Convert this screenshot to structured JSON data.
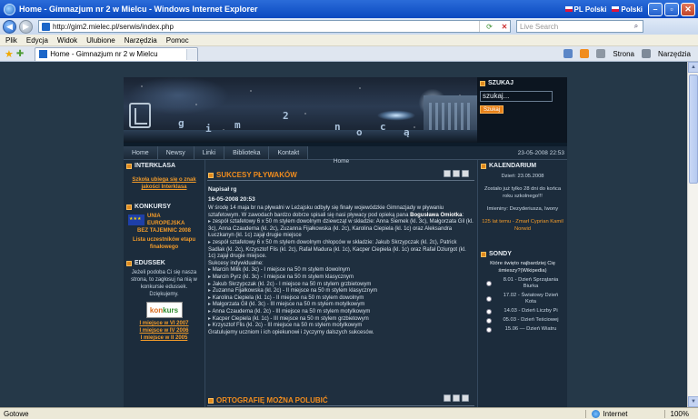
{
  "window": {
    "title": "Home - Gimnazjum nr 2 w Mielcu - Windows Internet Explorer",
    "lang1": "PL Polski",
    "lang2": "Polski"
  },
  "address": {
    "url": "http://gim2.mielec.pl/serwis/index.php",
    "search_placeholder": "Live Search"
  },
  "menu": [
    "Plik",
    "Edycja",
    "Widok",
    "Ulubione",
    "Narzędzia",
    "Pomoc"
  ],
  "tab": {
    "label": "Home - Gimnazjum nr 2 w Mielcu"
  },
  "tools": {
    "strona": "Strona",
    "narzedzia": "Narzędzia"
  },
  "status": {
    "left": "Gotowe",
    "zone": "Internet",
    "zoom": "100%"
  },
  "site": {
    "banner_letters": [
      "g",
      "i",
      "m",
      "2",
      "n",
      "o",
      "c",
      "ą"
    ],
    "search": {
      "title": "SZUKAJ",
      "value": "szukaj...",
      "button": "Szukaj"
    },
    "nav": [
      "Home",
      "Newsy",
      "Linki",
      "Biblioteka",
      "Kontakt"
    ],
    "datetime": "23-05-2008 22:53",
    "breadcrumb": "Home",
    "left": {
      "interklasa": {
        "title": "INTERKLASA",
        "text": "Szkoła ubiega się o znak jakości Interklasa"
      },
      "konkursy": {
        "title": "KONKURSY",
        "eu1": "UNIA",
        "eu2": "EUROPEJSKA",
        "eu3": "BEZ TAJEMNIC 2008",
        "link1": "Lista uczestników etapu finałowego"
      },
      "edussek": {
        "title": "EDUSSEK",
        "text": "Jeżeli podoba Ci się nasza strona, to zagłosuj na nią w konkursie edussek. Dziękujemy.",
        "logo1": "kon",
        "logo2": "kurs",
        "p1": "I miejsce w VI 2007",
        "p2": "I miejsce w IV 2006",
        "p3": "I miejsce w II 2005"
      }
    },
    "article1": {
      "title": "SUKCESY PŁYWAKÓW",
      "author": "Napisał rg",
      "date": "16-05-2008 20:53",
      "p1a": "W środę 14 maja br na pływalni w Leżajsku odbyły się finały wojewódzkie Gimnazjady w pływaniu sztafetowym. W zawodach bardzo dobrze spisali się nasi pływacy pod opieką pana ",
      "p1b": "Bogusława Omiotka",
      "p1c": ":",
      "r1": "zespół sztafetowy 6 x 50 m stylem dowolnym dziewcząt w składzie: Anna Siemek (kl. 3c), Małgorzata Gil (kl. 3c), Anna Czauderna (kl. 2c), Zuzanna Fijałkowska (kl. 2c), Karolina Ciepiela (kl. 1c) oraz Aleksandra Łuczkanyn (kl. 1c) zajął drugie miejsce",
      "r2": "zespół sztafetowy 6 x 50 m stylem dowolnym chłopców w składzie: Jakub Skrzypczak (kl. 2c), Patrick Sadlak (kl. 2c), Krzysztof Flis (kl. 2c), Rafał Madura (kl. 1c), Kacper Ciepiela (kl. 1c) oraz Rafał Dziurgot (kl. 1c) zajął drugie miejsce.",
      "ind": "Sukcesy indywidualne:",
      "i1": "Marcin Milik (kl. 3c) - I miejsce na 50 m stylem dowolnym",
      "i2": "Marcin Pyrz (kl. 3c) - I miejsce na 50 m stylem klasycznym",
      "i3": "Jakub Skrzypczak (kl. 2c) - I miejsce na 50 m stylem grzbietowym",
      "i4": "Zuzanna Fijałkowska (kl. 2c) - II miejsce na 50 m stylem klasycznym",
      "i5": "Karolina Ciepiela (kl. 1c) - II miejsce na 50 m stylem dowolnym",
      "i6": "Małgorzata Gil (kl. 3c) - III miejsce na 50 m stylem motylkowym",
      "i7": "Anna Czauderna (kl. 2c) - III miejsce na 50 m stylem motylkowym",
      "i8": "Kacper Ciepiela (kl. 1c) - III miejsce na 50 m stylem grzbietowym",
      "i9": "Krzysztof Flis (kl. 2c) - III miejsce na 50 m stylem motylkowym",
      "end": "Gratulujemy uczniom i ich opiekunowi i życzymy dalszych sukcesów."
    },
    "article2": {
      "title": "ORTOGRAFIĘ MOŻNA POLUBIĆ"
    },
    "right": {
      "kalendarium": {
        "title": "KALENDARIUM",
        "today": "Dzień: 23.05.2008",
        "left": "Zostało już tylko 28 dni do końca roku szkolnego!!!",
        "names": "Imieniny: Dezyderiusza, Iwony",
        "anniv": "125 lat temu - Zmarł Cyprian Kamil Norwid"
      },
      "sondy": {
        "title": "SONDY",
        "question": "Które święto najbardziej Cię śmieszy?(Wikipedia)",
        "options": [
          "8.01 - Dzień Sprzątania Biurka",
          "17.02 - Światowy Dzień Kota",
          "14.03 - Dzień Liczby Pi",
          "05.03 - Dzień Teściowej",
          "15.06 — Dzień Wiatru"
        ]
      }
    }
  }
}
